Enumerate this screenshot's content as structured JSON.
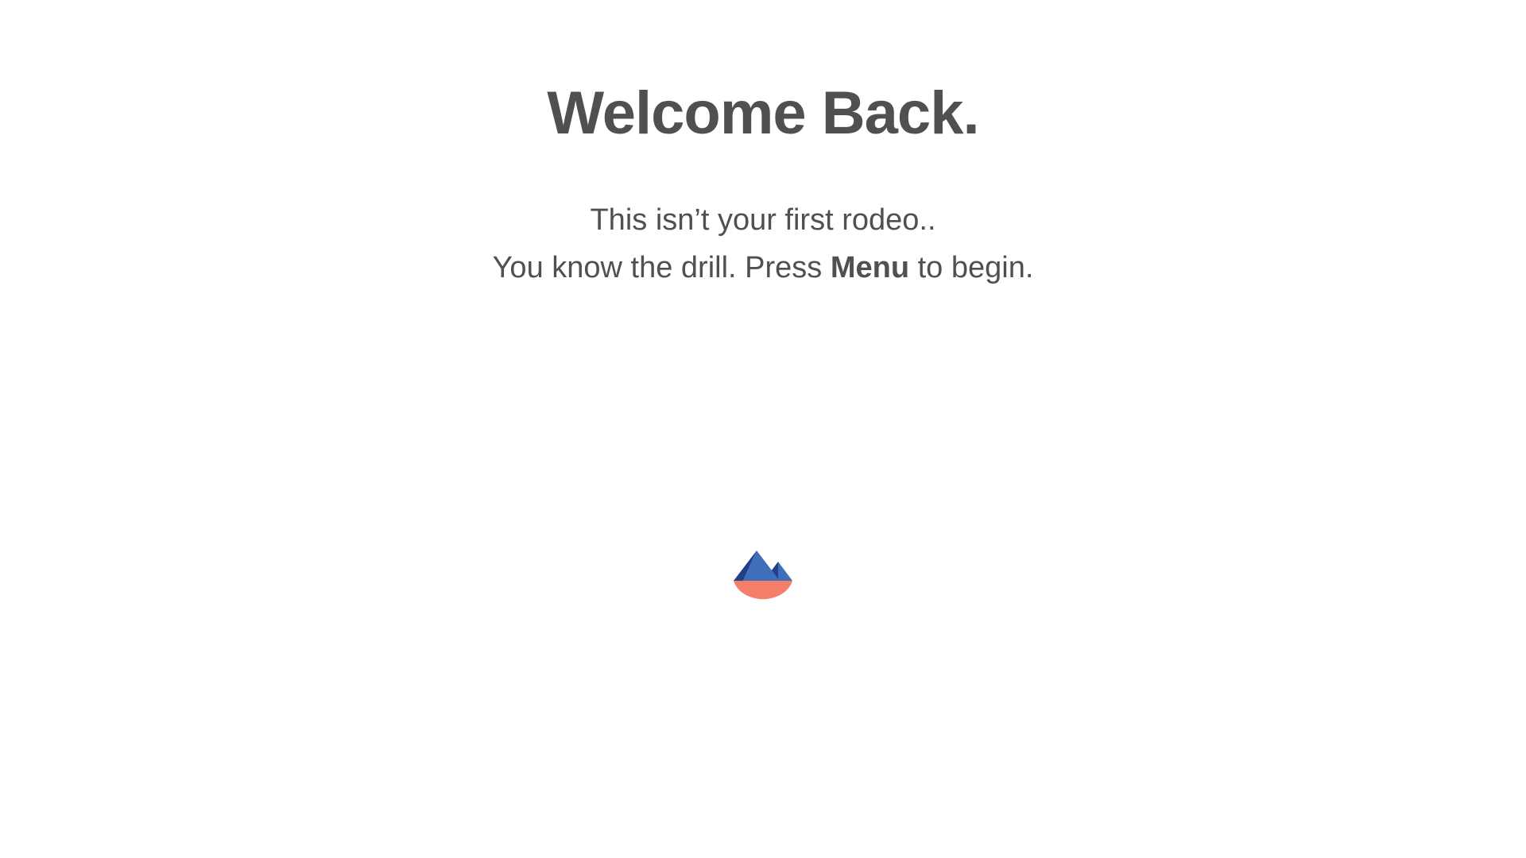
{
  "title": "Welcome Back.",
  "subtitle": {
    "line1": "This isn’t your first rodeo..",
    "line2_before": "You know the drill. Press ",
    "line2_emphasis": "Menu",
    "line2_after": " to begin."
  },
  "logo": {
    "icon": "mountain-lake-logo",
    "colors": {
      "mountain_light": "#3f6fba",
      "mountain_dark": "#22418a",
      "water": "#f47f68"
    }
  }
}
